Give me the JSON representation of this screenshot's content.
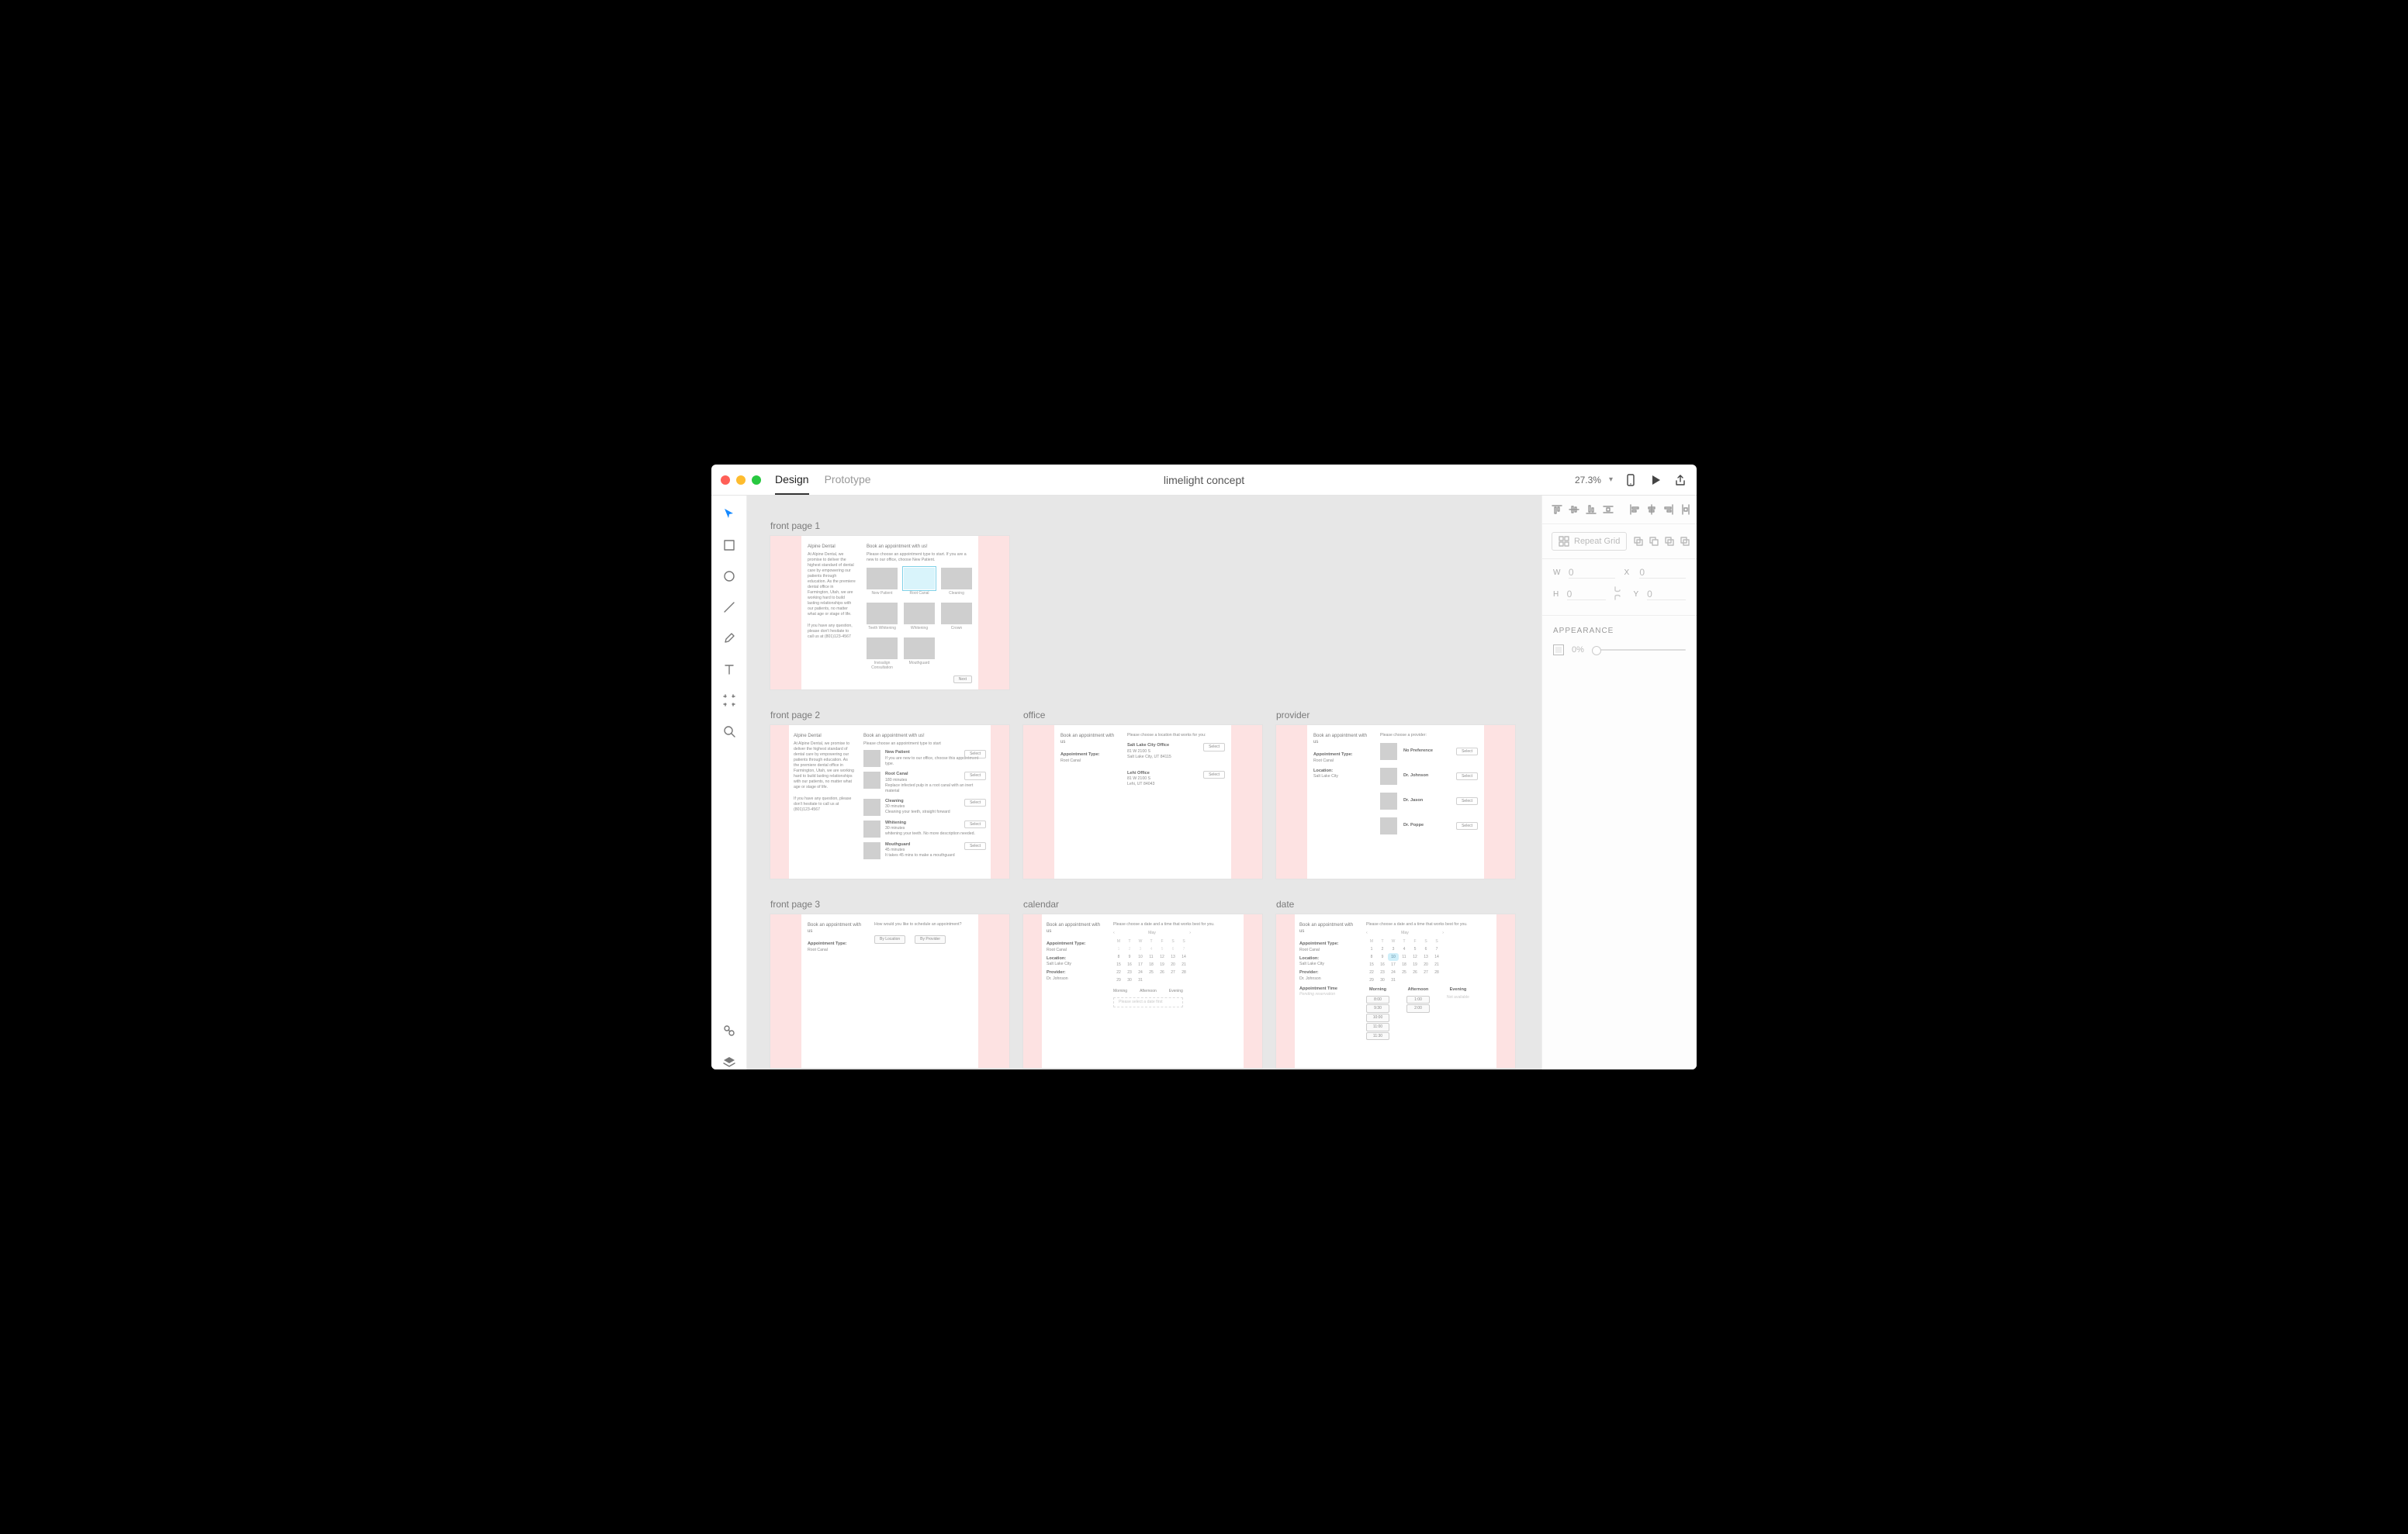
{
  "header": {
    "tabs": [
      "Design",
      "Prototype"
    ],
    "activeTab": 0,
    "title": "limelight concept",
    "zoom": "27.3%"
  },
  "tools": {
    "items": [
      "select",
      "rectangle",
      "ellipse",
      "line",
      "pen",
      "text",
      "artboard",
      "zoom"
    ],
    "active": 0,
    "bottom": [
      "assets",
      "layers"
    ]
  },
  "inspector": {
    "repeatGrid": "Repeat Grid",
    "dims": {
      "W": "0",
      "H": "0",
      "X": "0",
      "Y": "0"
    },
    "appearance": {
      "heading": "APPEARANCE",
      "opacity": "0%"
    }
  },
  "artboards": [
    {
      "key": "fp1",
      "name": "front page 1"
    },
    {
      "key": "fp2",
      "name": "front page 2"
    },
    {
      "key": "office",
      "name": "office"
    },
    {
      "key": "provider",
      "name": "provider"
    },
    {
      "key": "fp3",
      "name": "front page 3"
    },
    {
      "key": "calendar",
      "name": "calendar"
    },
    {
      "key": "date",
      "name": "date"
    }
  ],
  "content": {
    "alpine": {
      "brand": "Alpine Dental",
      "para": "At Alpine Dental, we promise to deliver the highest standard of dental care by empowering our patients through education. As the premiere dental office in Farmington, Utah, we are working hard to build lasting relationships with our patients, no matter what age or stage of life.",
      "contact": "If you have any question, please don't hesitate to call us at (801)123-4567"
    },
    "fp1": {
      "heading": "Book an appointment with us!",
      "sub": "Please choose an appointment type to start. If you are a new to our office, choose New Patient.",
      "types": [
        "New Patient",
        "Root Canal",
        "Cleaning",
        "Teeth Whitening",
        "Whitening",
        "Crown",
        "Invisalign Consultation",
        "Mouthguard"
      ],
      "selectedIndex": 1,
      "next": "Next"
    },
    "fp2": {
      "heading": "Book an appointment with us!",
      "sub": "Please choose an appointment type to start",
      "select": "Select",
      "items": [
        {
          "title": "New Patient",
          "desc": "If you are new to our office, choose this appointment type."
        },
        {
          "title": "Root Canal",
          "desc": "180 minutes\nReplace infected pulp in a root canal with an inert material"
        },
        {
          "title": "Cleaning",
          "desc": "30 minutes\nCleaning your teeth, straight forward"
        },
        {
          "title": "Whitening",
          "desc": "30 minutes\nwhitening your teeth. No more description needed."
        },
        {
          "title": "Mouthguard",
          "desc": "45 minutes\nIt takes 45 mins to make a mouthguard"
        }
      ]
    },
    "office": {
      "heading": "Book an appointment with us",
      "apTypeLabel": "Appointment Type:",
      "apType": "Root Canal",
      "sub": "Please choose a location that works for you:",
      "select": "Select",
      "locations": [
        {
          "name": "Salt Lake City Office",
          "addr1": "81 W 2100 S",
          "addr2": "Salt Lake City, UT 84115"
        },
        {
          "name": "Lehi Office",
          "addr1": "81 W 2100 S",
          "addr2": "Lehi, UT 84043"
        }
      ]
    },
    "provider": {
      "heading": "Book an appointment with us",
      "apTypeLabel": "Appointment Type:",
      "apType": "Root Canal",
      "locLabel": "Location:",
      "loc": "Salt Lake City",
      "sub": "Please choose a provider:",
      "select": "Select",
      "providers": [
        "No Preference",
        "Dr. Johnson",
        "Dr. Jason",
        "Dr. Poppe"
      ]
    },
    "fp3": {
      "heading": "Book an appointment with us",
      "apTypeLabel": "Appointment Type:",
      "apType": "Root Canal",
      "prompt": "How would you like to schedule an appointment?",
      "byLocation": "By Location",
      "byProvider": "By Provider"
    },
    "calendar": {
      "heading": "Book an appointment with us",
      "apTypeLabel": "Appointment Type:",
      "apType": "Root Canal",
      "locLabel": "Location:",
      "loc": "Salt Lake City",
      "provLabel": "Provider:",
      "prov": "Dr. Johnson",
      "sub": "Please choose a date and a time that works best for you.",
      "month": "May",
      "dow": [
        "M",
        "T",
        "W",
        "T",
        "F",
        "S",
        "S"
      ],
      "weeks": [
        [
          "1",
          "2",
          "3",
          "4",
          "5",
          "6",
          "7"
        ],
        [
          "8",
          "9",
          "10",
          "11",
          "12",
          "13",
          "14"
        ],
        [
          "15",
          "16",
          "17",
          "18",
          "19",
          "20",
          "21"
        ],
        [
          "22",
          "23",
          "24",
          "25",
          "26",
          "27",
          "28"
        ],
        [
          "29",
          "30",
          "31",
          "",
          "",
          "",
          ""
        ]
      ],
      "segments": [
        "Morning",
        "Afternoon",
        "Evening"
      ],
      "note": "Please select a date first"
    },
    "date": {
      "heading": "Book an appointment with us",
      "apTypeLabel": "Appointment Type:",
      "apType": "Root Canal",
      "locLabel": "Location:",
      "loc": "Salt Lake City",
      "provLabel": "Provider:",
      "prov": "Dr. Johnson",
      "apTimeLabel": "Appointment Time",
      "pending": "Pending reservation",
      "sub": "Please choose a date and a time that works best for you.",
      "month": "May",
      "dow": [
        "M",
        "T",
        "W",
        "T",
        "F",
        "S",
        "S"
      ],
      "today": "10",
      "weeks": [
        [
          "1",
          "2",
          "3",
          "4",
          "5",
          "6",
          "7"
        ],
        [
          "8",
          "9",
          "10",
          "11",
          "12",
          "13",
          "14"
        ],
        [
          "15",
          "16",
          "17",
          "18",
          "19",
          "20",
          "21"
        ],
        [
          "22",
          "23",
          "24",
          "25",
          "26",
          "27",
          "28"
        ],
        [
          "29",
          "30",
          "31",
          "",
          "",
          "",
          ""
        ]
      ],
      "segments": [
        "Morning",
        "Afternoon",
        "Evening"
      ],
      "morning": [
        "8:00",
        "9:30",
        "10:00",
        "11:00",
        "11:30"
      ],
      "afternoon": [
        "1:00",
        "2:00"
      ],
      "evening": "Not available"
    }
  }
}
